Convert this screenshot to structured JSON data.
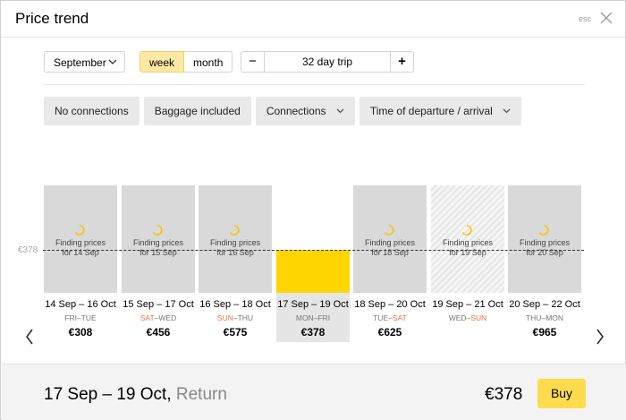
{
  "header": {
    "title": "Price trend",
    "esc_label": "esc"
  },
  "controls": {
    "month": "September",
    "mode_options": [
      "week",
      "month"
    ],
    "mode_selected": "week",
    "trip_minus": "−",
    "trip_plus": "+",
    "trip_value": "32 day trip"
  },
  "filters": [
    {
      "label": "No connections",
      "dropdown": false
    },
    {
      "label": "Baggage included",
      "dropdown": false
    },
    {
      "label": "Connections",
      "dropdown": true
    },
    {
      "label": "Time of departure / arrival",
      "dropdown": true
    }
  ],
  "chart": {
    "average_label": "€378",
    "finding_text": "Finding prices",
    "columns": [
      {
        "dates": "14 Sep – 16 Oct",
        "day_from": "FRI",
        "day_to": "TUE",
        "from_weekend": false,
        "to_weekend": false,
        "price": "€308",
        "finding_for": "for 14 Sep",
        "state": "loading"
      },
      {
        "dates": "15 Sep – 17 Oct",
        "day_from": "SAT",
        "day_to": "WED",
        "from_weekend": true,
        "to_weekend": false,
        "price": "€456",
        "finding_for": "for 15 Sep",
        "state": "loading"
      },
      {
        "dates": "16 Sep – 18 Oct",
        "day_from": "SUN",
        "day_to": "THU",
        "from_weekend": true,
        "to_weekend": false,
        "price": "€575",
        "finding_for": "for 16 Sep",
        "state": "loading"
      },
      {
        "dates": "17 Sep – 19 Oct",
        "day_from": "MON",
        "day_to": "FRI",
        "from_weekend": false,
        "to_weekend": false,
        "price": "€378",
        "finding_for": "",
        "state": "selected"
      },
      {
        "dates": "18 Sep – 20 Oct",
        "day_from": "TUE",
        "day_to": "SAT",
        "from_weekend": false,
        "to_weekend": true,
        "price": "€625",
        "finding_for": "for 18 Sep",
        "state": "loading"
      },
      {
        "dates": "19 Sep – 21 Oct",
        "day_from": "WED",
        "day_to": "SUN",
        "from_weekend": false,
        "to_weekend": true,
        "price": "",
        "finding_for": "for 19 Sep",
        "state": "hatched"
      },
      {
        "dates": "20 Sep – 22 Oct",
        "day_from": "THU",
        "day_to": "MON",
        "from_weekend": false,
        "to_weekend": false,
        "price": "€965",
        "finding_for": "for 20 Sep",
        "state": "loading"
      }
    ]
  },
  "footer": {
    "dates": "17 Sep – 19 Oct,",
    "trip_type": "Return",
    "price": "€378",
    "buy_label": "Buy"
  },
  "colors": {
    "accent": "#ffdb4d",
    "selected_bar": "#ffd600",
    "weekend": "#f07042"
  },
  "icons": {
    "close": "close-icon",
    "chevron": "chevron-down-icon",
    "spinner": "spinner-icon",
    "nav_prev": "chevron-left-icon",
    "nav_next": "chevron-right-icon"
  }
}
